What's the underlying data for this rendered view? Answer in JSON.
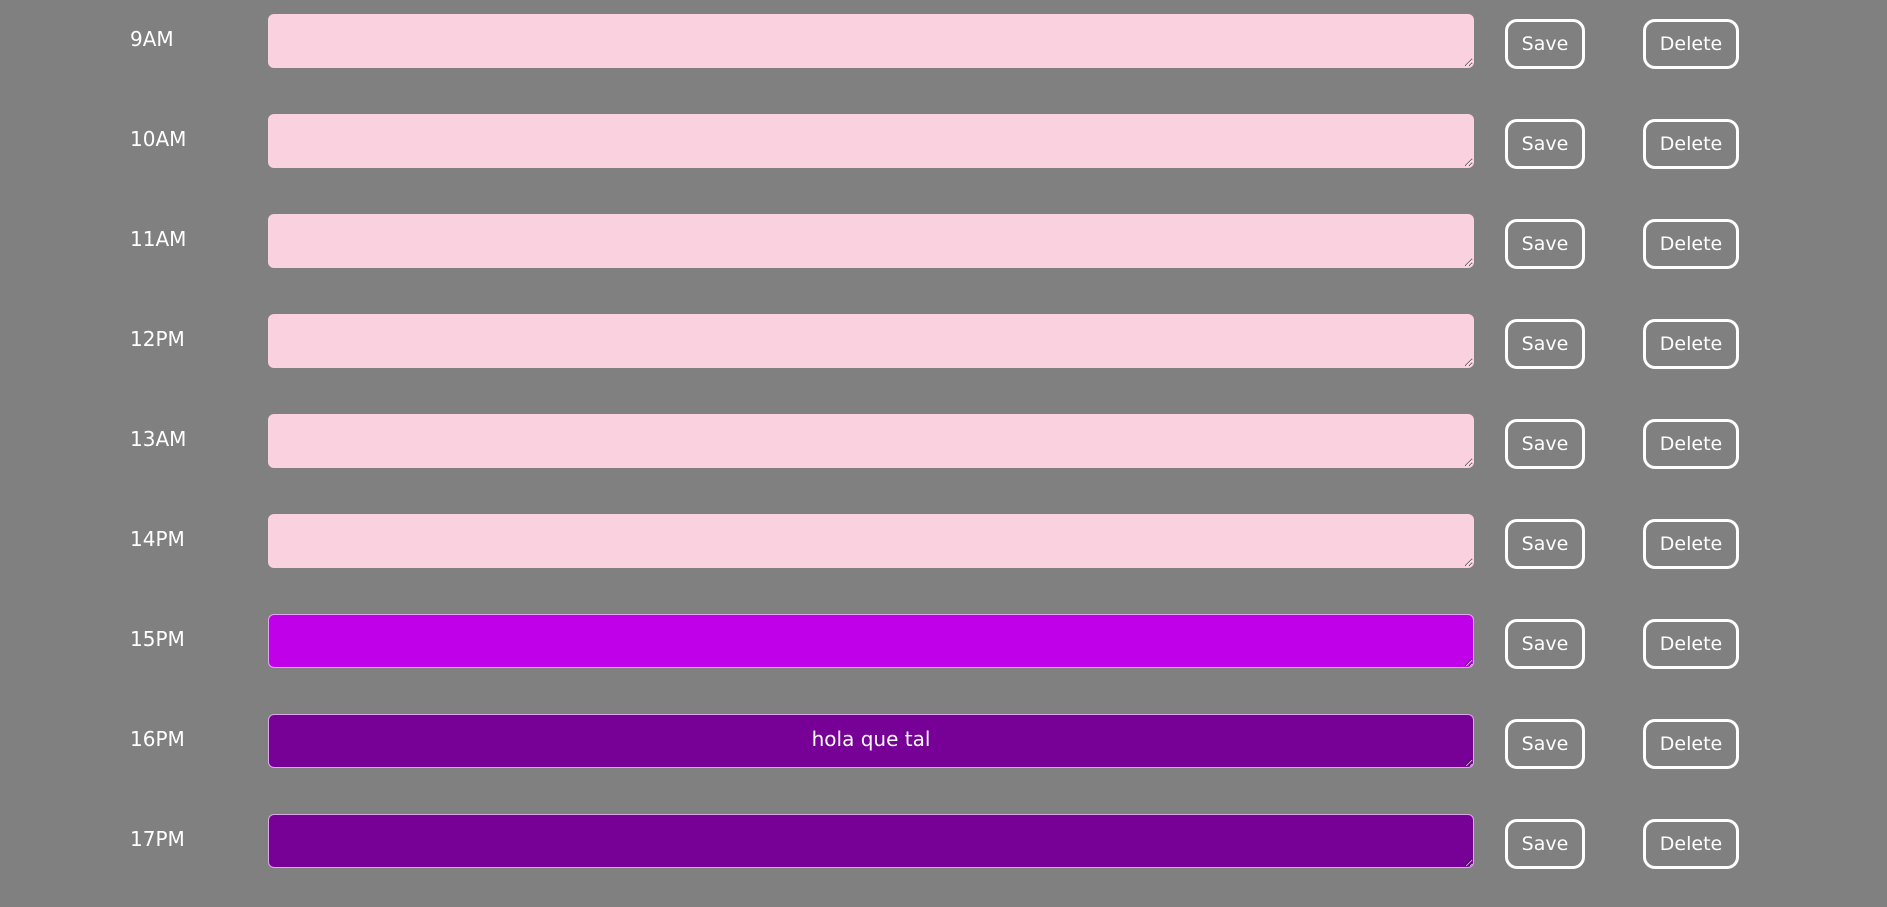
{
  "colors": {
    "background": "#808080",
    "past": "#f9d1df",
    "present": "#bf00e8",
    "future": "#770096",
    "text": "#ffffff"
  },
  "buttons": {
    "save_label": "Save",
    "delete_label": "Delete"
  },
  "rows": [
    {
      "hour": "9AM",
      "status": "past",
      "text": ""
    },
    {
      "hour": "10AM",
      "status": "past",
      "text": ""
    },
    {
      "hour": "11AM",
      "status": "past",
      "text": ""
    },
    {
      "hour": "12PM",
      "status": "past",
      "text": ""
    },
    {
      "hour": "13AM",
      "status": "past",
      "text": ""
    },
    {
      "hour": "14PM",
      "status": "past",
      "text": ""
    },
    {
      "hour": "15PM",
      "status": "present",
      "text": ""
    },
    {
      "hour": "16PM",
      "status": "future",
      "text": "hola que tal"
    },
    {
      "hour": "17PM",
      "status": "future",
      "text": ""
    }
  ]
}
